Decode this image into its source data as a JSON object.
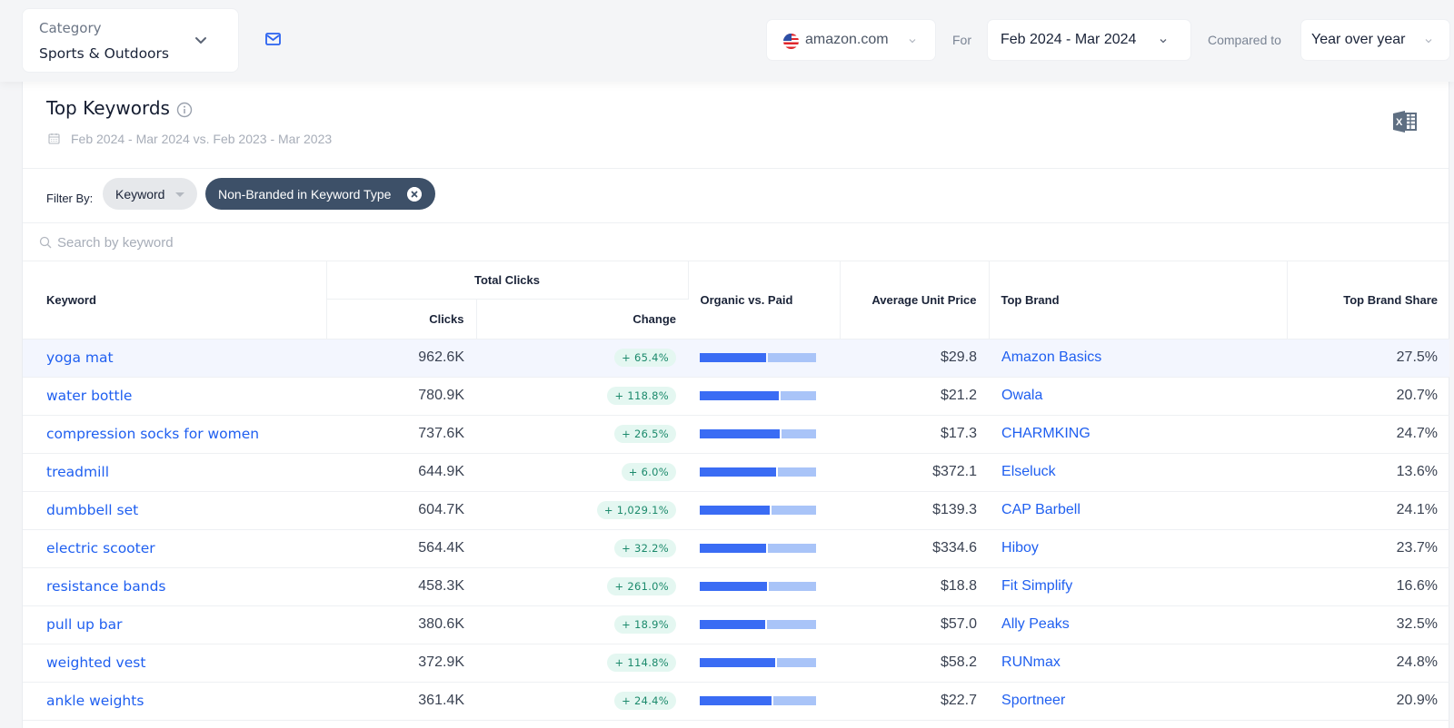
{
  "topbar": {
    "category_label": "Category",
    "category_value": "Sports & Outdoors",
    "market": "amazon.com",
    "for_label": "For",
    "date_range": "Feb 2024 - Mar 2024",
    "compared_label": "Compared to",
    "compare_mode": "Year over year"
  },
  "panel": {
    "title": "Top Keywords",
    "date_comparison": "Feb 2024 - Mar 2024 vs. Feb 2023 - Mar 2023",
    "filter_label": "Filter By:",
    "filter_dropdown": "Keyword",
    "active_filter": "Non-Branded in Keyword Type",
    "search_placeholder": "Search by keyword",
    "search_value": ""
  },
  "table": {
    "headers": {
      "keyword": "Keyword",
      "total_clicks": "Total Clicks",
      "clicks": "Clicks",
      "change": "Change",
      "organic_paid": "Organic vs. Paid",
      "avg_price": "Average Unit Price",
      "top_brand": "Top Brand",
      "top_brand_share": "Top Brand Share"
    },
    "colors": {
      "organic": "#3a6cf4",
      "paid": "#a9c4f8",
      "link": "#1f5ff0",
      "positive": "#1c8a6c"
    },
    "rows": [
      {
        "keyword": "yoga mat",
        "clicks": "962.6K",
        "change": "+ 65.4%",
        "organic_share": 0.58,
        "price": "$29.8",
        "brand": "Amazon Basics",
        "share": "27.5%"
      },
      {
        "keyword": "water bottle",
        "clicks": "780.9K",
        "change": "+ 118.8%",
        "organic_share": 0.69,
        "price": "$21.2",
        "brand": "Owala",
        "share": "20.7%"
      },
      {
        "keyword": "compression socks for women",
        "clicks": "737.6K",
        "change": "+ 26.5%",
        "organic_share": 0.7,
        "price": "$17.3",
        "brand": "CHARMKING",
        "share": "24.7%"
      },
      {
        "keyword": "treadmill",
        "clicks": "644.9K",
        "change": "+ 6.0%",
        "organic_share": 0.67,
        "price": "$372.1",
        "brand": "Elseluck",
        "share": "13.6%"
      },
      {
        "keyword": "dumbbell set",
        "clicks": "604.7K",
        "change": "+ 1,029.1%",
        "organic_share": 0.61,
        "price": "$139.3",
        "brand": "CAP Barbell",
        "share": "24.1%"
      },
      {
        "keyword": "electric scooter",
        "clicks": "564.4K",
        "change": "+ 32.2%",
        "organic_share": 0.58,
        "price": "$334.6",
        "brand": "Hiboy",
        "share": "23.7%"
      },
      {
        "keyword": "resistance bands",
        "clicks": "458.3K",
        "change": "+ 261.0%",
        "organic_share": 0.59,
        "price": "$18.8",
        "brand": "Fit Simplify",
        "share": "16.6%"
      },
      {
        "keyword": "pull up bar",
        "clicks": "380.6K",
        "change": "+ 18.9%",
        "organic_share": 0.57,
        "price": "$57.0",
        "brand": "Ally Peaks",
        "share": "32.5%"
      },
      {
        "keyword": "weighted vest",
        "clicks": "372.9K",
        "change": "+ 114.8%",
        "organic_share": 0.66,
        "price": "$58.2",
        "brand": "RUNmax",
        "share": "24.8%"
      },
      {
        "keyword": "ankle weights",
        "clicks": "361.4K",
        "change": "+ 24.4%",
        "organic_share": 0.63,
        "price": "$22.7",
        "brand": "Sportneer",
        "share": "20.9%"
      }
    ]
  }
}
